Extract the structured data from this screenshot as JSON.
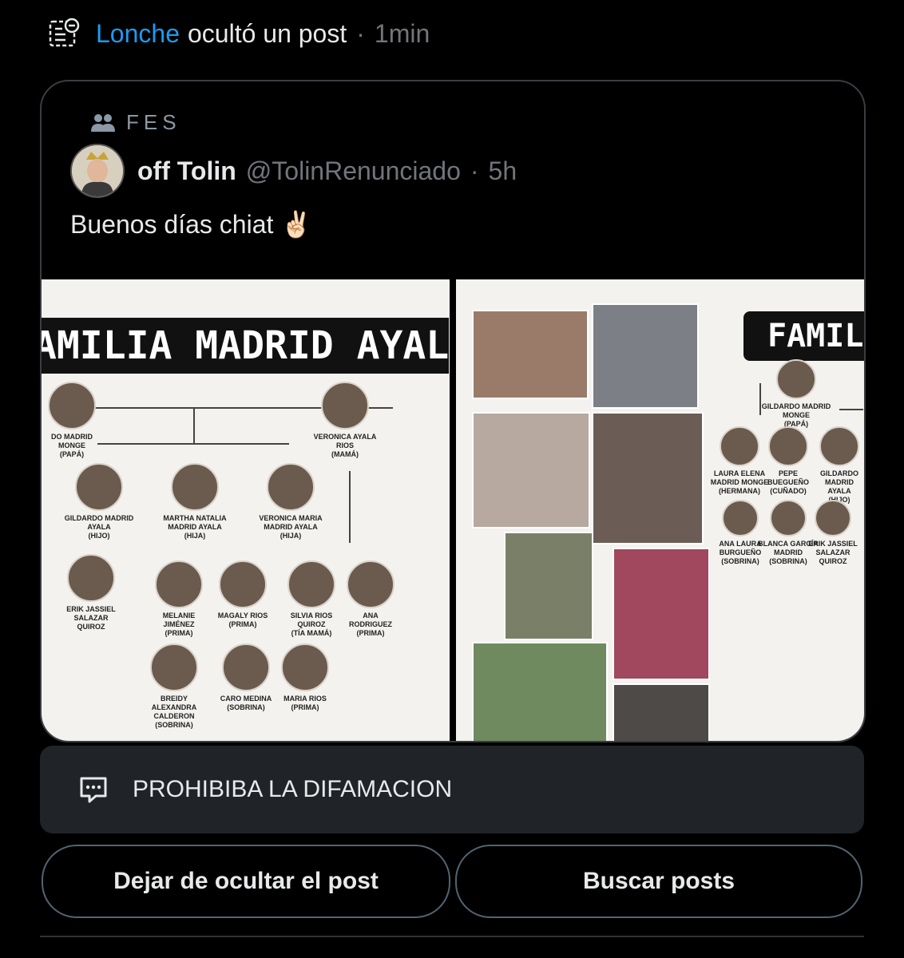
{
  "notice": {
    "user": "Lonche",
    "action": "ocultó un post",
    "separator": "·",
    "time": "1min"
  },
  "post": {
    "community": "FES",
    "author_name": "off Tolin",
    "author_handle": "@TolinRenunciado",
    "separator": "·",
    "time": "5h",
    "text": "Buenos días chiat ✌🏻"
  },
  "image_left": {
    "banner": "AMILIA  MADRID AYALA",
    "people": [
      {
        "label": "DO MADRID\nMONGE\n(PAPÁ)"
      },
      {
        "label": "VERONICA AYALA\nRIOS\n(MAMÁ)"
      },
      {
        "label": "GILDARDO MADRID\nAYALA\n(HIJO)"
      },
      {
        "label": "MARTHA NATALIA\nMADRID AYALA\n(HIJA)"
      },
      {
        "label": "VERONICA MARIA\nMADRID AYALA\n(HIJA)"
      },
      {
        "label": "ERIK JASSIEL\nSALAZAR\nQUIROZ"
      },
      {
        "label": "MELANIE\nJIMÉNEZ\n(PRIMA)"
      },
      {
        "label": "MAGALY RIOS\n(PRIMA)"
      },
      {
        "label": "SILVIA RIOS\nQUIROZ\n(TÍA MAMÁ)"
      },
      {
        "label": "ANA\nRODRIGUEZ\n(PRIMA)"
      },
      {
        "label": "BREIDY\nALEXANDRA\nCALDERON\n(SOBRINA)"
      },
      {
        "label": "CARO MEDINA\n(SOBRINA)"
      },
      {
        "label": "MARIA RIOS\n(PRIMA)"
      }
    ]
  },
  "image_right": {
    "banner": "FAMILI",
    "people": [
      {
        "label": "GILDARDO MADRID\nMONGE\n(PAPÁ)"
      },
      {
        "label": "LAURA ELENA\nMADRID MONGE\n(HERMANA)"
      },
      {
        "label": "PEPE\nBUEGUEÑO\n(CUÑADO)"
      },
      {
        "label": "GILDARDO MADRID\nAYALA\n(HIJO)"
      },
      {
        "label": "ANA LAURA\nBURGUEÑO\n(SOBRINA)"
      },
      {
        "label": "BLANCA GARCÍA\nMADRID\n(SOBRINA)"
      },
      {
        "label": "ERIK JASSIEL\nSALAZAR\nQUIROZ"
      }
    ]
  },
  "reason": "PROHIBIBA LA DIFAMACION",
  "buttons": {
    "unhide": "Dejar de ocultar el post",
    "search": "Buscar posts"
  }
}
